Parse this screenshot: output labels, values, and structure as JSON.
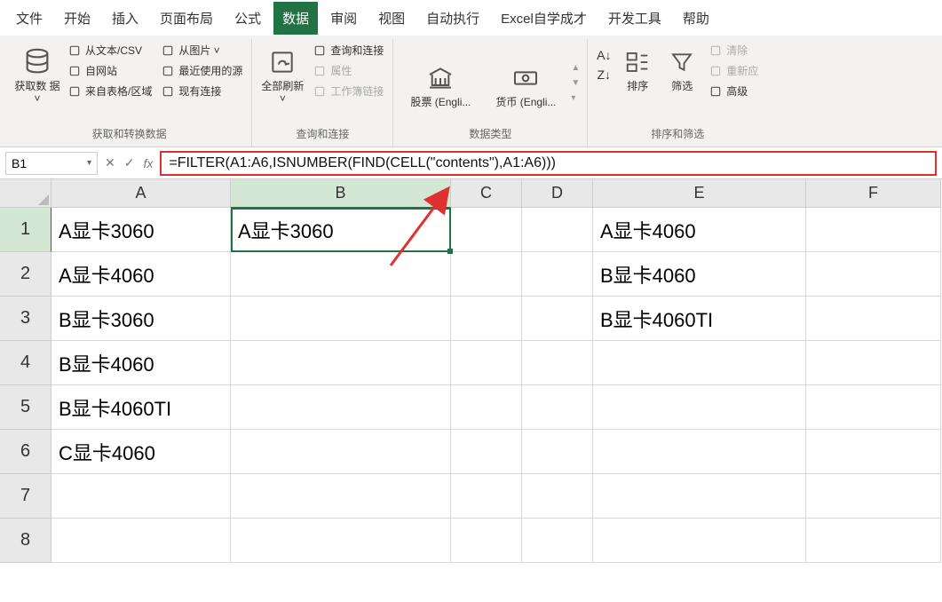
{
  "menu": {
    "items": [
      "文件",
      "开始",
      "插入",
      "页面布局",
      "公式",
      "数据",
      "审阅",
      "视图",
      "自动执行",
      "Excel自学成才",
      "开发工具",
      "帮助"
    ],
    "active_index": 5
  },
  "ribbon": {
    "groups": [
      {
        "label": "获取和转换数据",
        "big": {
          "icon": "database",
          "label": "获取数\n据 ˅"
        },
        "cols": [
          [
            {
              "icon": "file",
              "label": "从文本/CSV"
            },
            {
              "icon": "globe",
              "label": "自网站"
            },
            {
              "icon": "grid",
              "label": "来自表格/区域"
            }
          ],
          [
            {
              "icon": "image",
              "label": "从图片 ˅"
            },
            {
              "icon": "recent",
              "label": "最近使用的源"
            },
            {
              "icon": "link",
              "label": "现有连接"
            }
          ]
        ]
      },
      {
        "label": "查询和连接",
        "big": {
          "icon": "refresh",
          "label": "全部刷新\n˅"
        },
        "cols": [
          [
            {
              "icon": "conn",
              "label": "查询和连接"
            },
            {
              "icon": "prop",
              "label": "属性",
              "disabled": true
            },
            {
              "icon": "wblink",
              "label": "工作簿链接",
              "disabled": true
            }
          ]
        ]
      },
      {
        "label": "数据类型",
        "big_row": [
          {
            "icon": "bank",
            "label": "股票 (Engli..."
          },
          {
            "icon": "money",
            "label": "货币 (Engli..."
          }
        ],
        "scroll": true
      },
      {
        "label": "排序和筛选",
        "items": [
          {
            "type": "mini-col",
            "items": [
              {
                "icon": "az",
                "label": ""
              },
              {
                "icon": "za",
                "label": ""
              }
            ]
          },
          {
            "type": "big",
            "icon": "sort",
            "label": "排序"
          },
          {
            "type": "big",
            "icon": "filter",
            "label": "筛选"
          },
          {
            "type": "mini-col",
            "items": [
              {
                "icon": "clear",
                "label": "清除",
                "disabled": true
              },
              {
                "icon": "reapply",
                "label": "重新应",
                "disabled": true
              },
              {
                "icon": "adv",
                "label": "高级"
              }
            ]
          }
        ]
      }
    ]
  },
  "namebox": {
    "value": "B1"
  },
  "formula_bar": {
    "fx_label": "fx",
    "formula": "=FILTER(A1:A6,ISNUMBER(FIND(CELL(\"contents\"),A1:A6)))"
  },
  "columns": [
    "A",
    "B",
    "C",
    "D",
    "E",
    "F"
  ],
  "row_count": 8,
  "cells": {
    "A1": "A显卡3060",
    "A2": "A显卡4060",
    "A3": "B显卡3060",
    "A4": "B显卡4060",
    "A5": "B显卡4060TI",
    "A6": "C显卡4060",
    "B1": "A显卡3060",
    "E1": "A显卡4060",
    "E2": "B显卡4060",
    "E3": "B显卡4060TI"
  },
  "active_cell": "B1"
}
